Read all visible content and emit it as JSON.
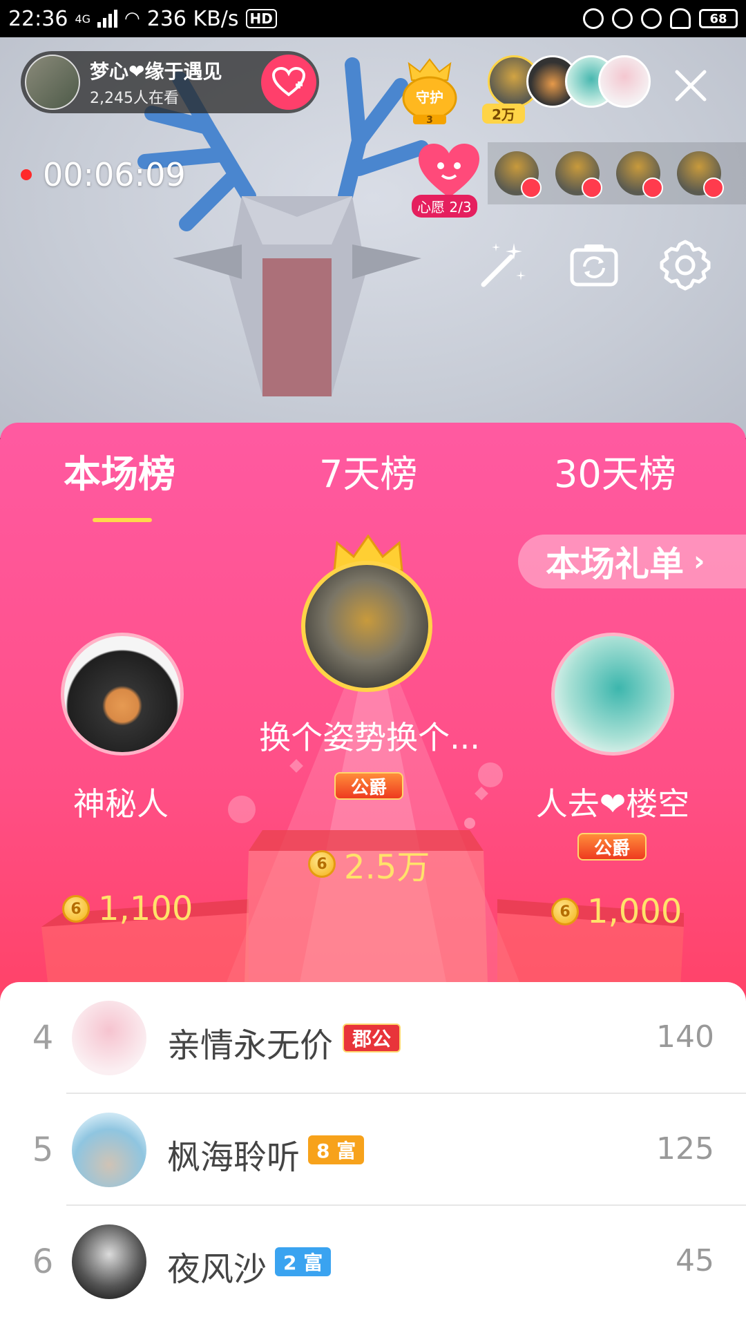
{
  "status_bar": {
    "time": "22:36",
    "network": "4G",
    "speed": "236 KB/s",
    "hd": "HD",
    "battery": "68"
  },
  "live": {
    "anchor_name": "梦心❤缘于遇见",
    "viewers": "2,245人在看",
    "guard_label": "守护",
    "guard_count": "3",
    "top_viewer_value": "2万",
    "timer": "00:06:09",
    "wish_label": "心愿 2/3"
  },
  "ranking": {
    "tabs": [
      "本场榜",
      "7天榜",
      "30天榜"
    ],
    "active_tab": 0,
    "gift_list_label": "本场礼单",
    "podium": [
      {
        "rank": 2,
        "name": "神秘人",
        "title": "",
        "score": "1,100"
      },
      {
        "rank": 1,
        "name": "换个姿势换个...",
        "title": "公爵",
        "score": "2.5万"
      },
      {
        "rank": 3,
        "name": "人去❤楼空",
        "title": "公爵",
        "score": "1,000"
      }
    ],
    "list": [
      {
        "rank": "4",
        "name": "亲情永无价",
        "badge": "郡公",
        "badge_color": "#e8343a",
        "score": "140"
      },
      {
        "rank": "5",
        "name": "枫海聆听",
        "badge": "8 富",
        "badge_color": "#f7a21b",
        "score": "125"
      },
      {
        "rank": "6",
        "name": "夜风沙",
        "badge": "2 富",
        "badge_color": "#3aa3f0",
        "score": "45"
      }
    ]
  },
  "colors": {
    "accent": "#ff4f86",
    "gold": "#ffe26a",
    "tab_underline": "#ffd94a"
  }
}
